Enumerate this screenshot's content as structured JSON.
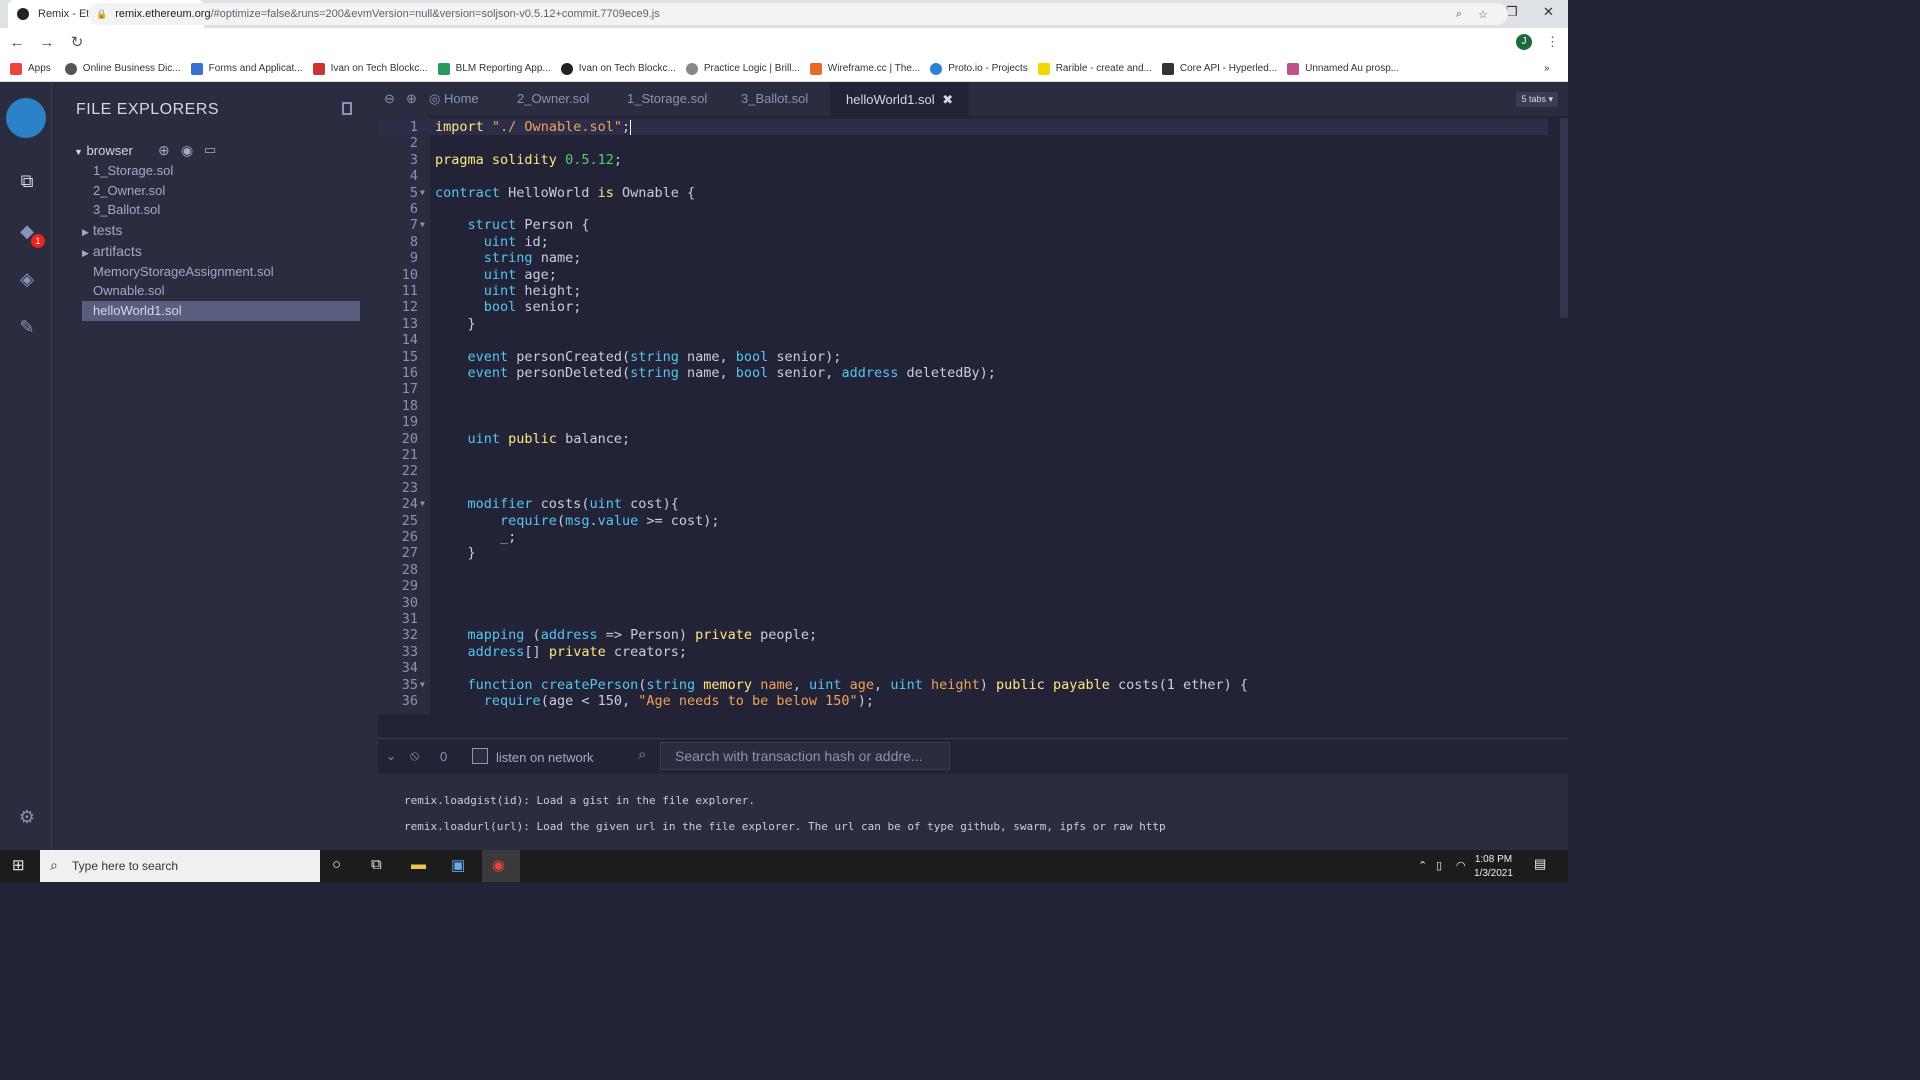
{
  "browser": {
    "tab_title": "Remix - Ethereum IDE",
    "url_domain": "remix.ethereum.org",
    "url_rest": "/#optimize=false&runs=200&evmVersion=null&version=soljson-v0.5.12+commit.7709ece9.js",
    "avatar": "J"
  },
  "bookmarks": [
    "Apps",
    "Online Business Dic...",
    "Forms and Applicat...",
    "Ivan on Tech Blockc...",
    "BLM Reporting App...",
    "Ivan on Tech Blockc...",
    "Practice Logic | Brill...",
    "Wireframe.cc | The...",
    "Proto.io - Projects",
    "Rarible - create and...",
    "Core API - Hyperled...",
    "Unnamed Au prosp..."
  ],
  "iconbar": {
    "badge": "1"
  },
  "file_explorer": {
    "title": "FILE EXPLORERS",
    "root": "browser",
    "items": [
      "1_Storage.sol",
      "2_Owner.sol",
      "3_Ballot.sol",
      "tests",
      "artifacts",
      "MemoryStorageAssignment.sol",
      "Ownable.sol",
      "helloWorld1.sol"
    ]
  },
  "editor": {
    "tabs": [
      "Home",
      "2_Owner.sol",
      "1_Storage.sol",
      "3_Ballot.sol",
      "helloWorld1.sol"
    ],
    "tabs_count": "5 tabs"
  },
  "terminal": {
    "count": "0",
    "listen_label": "listen on network",
    "search_placeholder": "Search with transaction hash or addre...",
    "lines": [
      "remix.loadgist(id): Load a gist in the file explorer.",
      "remix.loadurl(url): Load the given url in the file explorer. The url can be of type github, swarm, ipfs or raw http"
    ]
  },
  "taskbar": {
    "search_placeholder": "Type here to search",
    "time": "1:08 PM",
    "date": "1/3/2021"
  },
  "colors": {
    "keyword_yellow": "#ffe680",
    "type_blue": "#56c4f0",
    "string_orange": "#f0a25a",
    "number_green": "#4fd26a"
  }
}
